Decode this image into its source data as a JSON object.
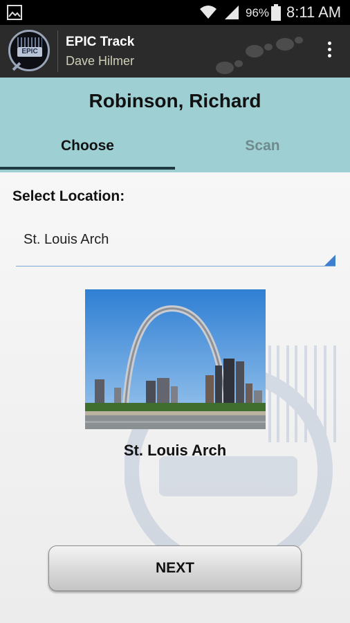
{
  "status_bar": {
    "battery_percent": "96%",
    "time": "8:11 AM",
    "icons": [
      "gallery-icon",
      "wifi-icon",
      "signal-icon",
      "battery-icon"
    ]
  },
  "app_bar": {
    "title": "EPIC Track",
    "subtitle": "Dave Hilmer",
    "logo_text": "EPIC",
    "icons": [
      "app-logo",
      "footprints-icon",
      "overflow-menu-icon"
    ]
  },
  "header": {
    "patient_name": "Robinson, Richard",
    "tabs": [
      {
        "label": "Choose",
        "active": true
      },
      {
        "label": "Scan",
        "active": false
      }
    ]
  },
  "form": {
    "select_label": "Select Location:",
    "selected_location": "St. Louis Arch"
  },
  "location": {
    "caption": "St. Louis Arch"
  },
  "actions": {
    "next_label": "NEXT"
  },
  "colors": {
    "status_bar": "#000000",
    "app_bar": "#2b2b2b",
    "header_band": "#9dcfd3",
    "tab_indicator": "#1e3a40",
    "select_underline": "#7aa7d6",
    "select_caret": "#3f7fcf"
  }
}
